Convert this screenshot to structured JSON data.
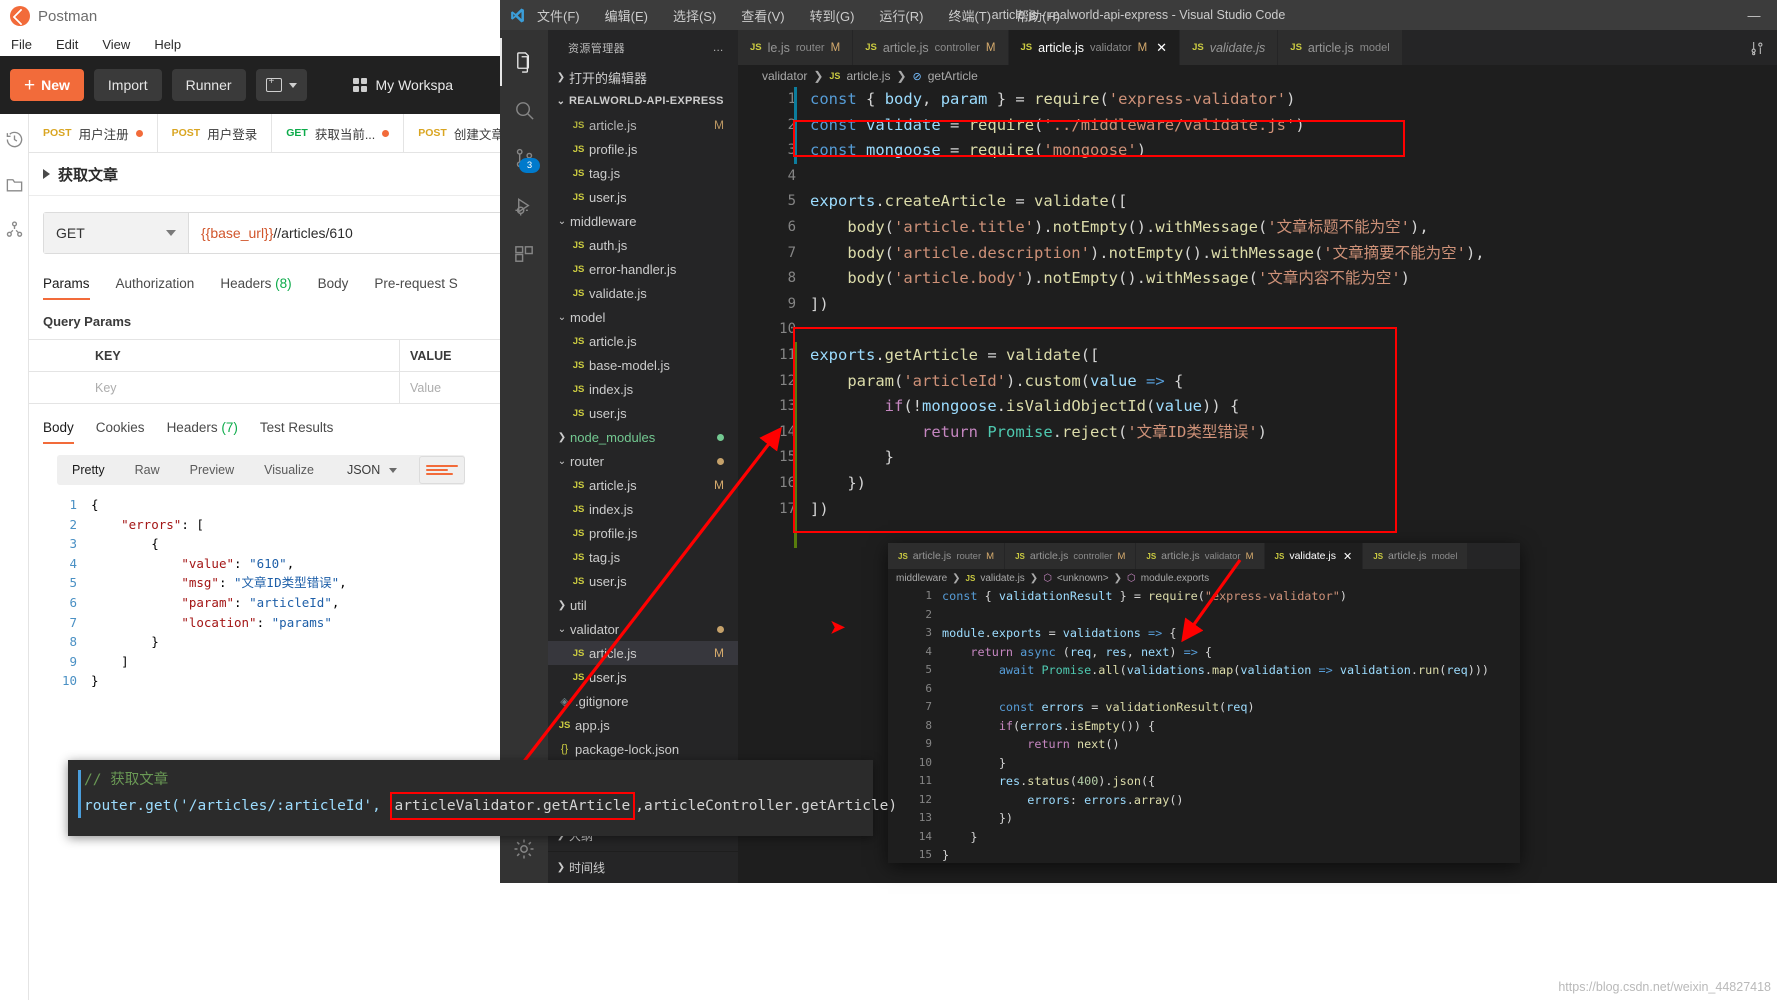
{
  "postman": {
    "app_title": "Postman",
    "menu": [
      "File",
      "Edit",
      "View",
      "Help"
    ],
    "toolbar": {
      "new_label": "New",
      "import_label": "Import",
      "runner_label": "Runner",
      "workspace_label": "My Workspa"
    },
    "request_tabs": [
      {
        "method": "POST",
        "name": "用户注册",
        "dirty": true
      },
      {
        "method": "POST",
        "name": "用户登录",
        "dirty": false
      },
      {
        "method": "GET",
        "name": "获取当前...",
        "dirty": true
      },
      {
        "method": "POST",
        "name": "创建文章",
        "dirty": false
      }
    ],
    "breadcrumb": "获取文章",
    "url_bar": {
      "method": "GET",
      "variable": "{{base_url}}",
      "path": "//articles/610"
    },
    "request_tabs_row": [
      {
        "label": "Params",
        "active": true
      },
      {
        "label": "Authorization",
        "active": false
      },
      {
        "label": "Headers",
        "count": "(8)",
        "active": false
      },
      {
        "label": "Body",
        "active": false
      },
      {
        "label": "Pre-request S",
        "active": false
      }
    ],
    "query_params_title": "Query Params",
    "table": {
      "headers": [
        "KEY",
        "VALUE"
      ],
      "placeholder_row": [
        "Key",
        "Value"
      ]
    },
    "response_tabs": [
      {
        "label": "Body",
        "active": true
      },
      {
        "label": "Cookies",
        "active": false
      },
      {
        "label": "Headers",
        "count": "(7)",
        "active": false
      },
      {
        "label": "Test Results",
        "active": false
      }
    ],
    "format_bar": {
      "modes": [
        "Pretty",
        "Raw",
        "Preview",
        "Visualize"
      ],
      "active_mode": "Pretty",
      "content_type": "JSON"
    },
    "response_json_lines": [
      {
        "n": "1",
        "text": "{"
      },
      {
        "n": "2",
        "text": "    \"errors\": ["
      },
      {
        "n": "3",
        "text": "        {"
      },
      {
        "n": "4",
        "text": "            \"value\": \"610\","
      },
      {
        "n": "5",
        "text": "            \"msg\": \"文章ID类型错误\","
      },
      {
        "n": "6",
        "text": "            \"param\": \"articleId\","
      },
      {
        "n": "7",
        "text": "            \"location\": \"params\""
      },
      {
        "n": "8",
        "text": "        }"
      },
      {
        "n": "9",
        "text": "    ]"
      },
      {
        "n": "10",
        "text": "}"
      }
    ]
  },
  "vscode": {
    "window_title": "article.js - realworld-api-express - Visual Studio Code",
    "menu": [
      "文件(F)",
      "编辑(E)",
      "选择(S)",
      "查看(V)",
      "转到(G)",
      "运行(R)",
      "终端(T)",
      "帮助(H)"
    ],
    "minimize_label": "—",
    "sidebar": {
      "header": "资源管理器",
      "more_label": "…",
      "open_editors": "打开的编辑器",
      "project_root": "REALWORLD-API-EXPRESS",
      "outline": "大纲",
      "timeline": "时间线",
      "tree": [
        {
          "indent": 2,
          "icon": "js",
          "name": "article.js",
          "mark": "M",
          "cut": true
        },
        {
          "indent": 2,
          "icon": "js",
          "name": "profile.js"
        },
        {
          "indent": 2,
          "icon": "js",
          "name": "tag.js"
        },
        {
          "indent": 2,
          "icon": "js",
          "name": "user.js"
        },
        {
          "indent": 1,
          "icon": "open",
          "name": "middleware",
          "folder": true
        },
        {
          "indent": 2,
          "icon": "js",
          "name": "auth.js"
        },
        {
          "indent": 2,
          "icon": "js",
          "name": "error-handler.js"
        },
        {
          "indent": 2,
          "icon": "js",
          "name": "validate.js"
        },
        {
          "indent": 1,
          "icon": "open",
          "name": "model",
          "folder": true
        },
        {
          "indent": 2,
          "icon": "js",
          "name": "article.js"
        },
        {
          "indent": 2,
          "icon": "js",
          "name": "base-model.js"
        },
        {
          "indent": 2,
          "icon": "js",
          "name": "index.js"
        },
        {
          "indent": 2,
          "icon": "js",
          "name": "user.js"
        },
        {
          "indent": 1,
          "icon": "closed",
          "name": "node_modules",
          "folder": true,
          "green": true,
          "dot": "#73c991"
        },
        {
          "indent": 1,
          "icon": "open",
          "name": "router",
          "folder": true,
          "dot": "#c5a16a"
        },
        {
          "indent": 2,
          "icon": "js",
          "name": "article.js",
          "mark": "M"
        },
        {
          "indent": 2,
          "icon": "js",
          "name": "index.js"
        },
        {
          "indent": 2,
          "icon": "js",
          "name": "profile.js"
        },
        {
          "indent": 2,
          "icon": "js",
          "name": "tag.js"
        },
        {
          "indent": 2,
          "icon": "js",
          "name": "user.js"
        },
        {
          "indent": 1,
          "icon": "closed",
          "name": "util",
          "folder": true
        },
        {
          "indent": 1,
          "icon": "open",
          "name": "validator",
          "folder": true,
          "dot": "#c5a16a"
        },
        {
          "indent": 2,
          "icon": "js",
          "name": "article.js",
          "mark": "M",
          "selected": true
        },
        {
          "indent": 2,
          "icon": "js",
          "name": "user.js"
        },
        {
          "indent": 1,
          "icon": "git",
          "name": ".gitignore"
        },
        {
          "indent": 1,
          "icon": "js",
          "name": "app.js"
        },
        {
          "indent": 1,
          "icon": "json",
          "name": "package-lock.json"
        }
      ]
    },
    "editor_tabs": [
      {
        "js": "JS",
        "name": "le.js",
        "desc": "router",
        "mark": "M",
        "active": false,
        "italic": false
      },
      {
        "js": "JS",
        "name": "article.js",
        "desc": "controller",
        "mark": "M",
        "active": false,
        "italic": false
      },
      {
        "js": "JS",
        "name": "article.js",
        "desc": "validator",
        "mark": "M",
        "active": true,
        "italic": false,
        "close": "✕"
      },
      {
        "js": "JS",
        "name": "validate.js",
        "desc": "",
        "mark": "",
        "active": false,
        "italic": true
      },
      {
        "js": "JS",
        "name": "article.js",
        "desc": "model",
        "mark": "",
        "active": false,
        "italic": false
      }
    ],
    "breadcrumb": {
      "folder": "validator",
      "file": "article.js",
      "symbol": "getArticle"
    },
    "code_lines": [
      {
        "n": "1",
        "html": "<span class=\"kw\">const</span> <span class=\"op\">{</span> <span class=\"vr\">body</span><span class=\"op\">,</span> <span class=\"vr\">param</span> <span class=\"op\">}</span> <span class=\"op\">=</span> <span class=\"fn\">require</span><span class=\"op\">(</span><span class=\"st\">'express-validator'</span><span class=\"op\">)</span>"
      },
      {
        "n": "2",
        "html": "<span class=\"kw\">const</span> <span class=\"vr\">validate</span> <span class=\"op\">=</span> <span class=\"fn\">require</span><span class=\"op\">(</span><span class=\"st\">'../middleware/validate.js'</span><span class=\"op\">)</span>"
      },
      {
        "n": "3",
        "html": "<span class=\"kw\">const</span> <span class=\"vr\">mongoose</span> <span class=\"op\">=</span> <span class=\"fn\">require</span><span class=\"op\">(</span><span class=\"st\">'mongoose'</span><span class=\"op\">)</span>"
      },
      {
        "n": "4",
        "html": ""
      },
      {
        "n": "5",
        "html": "<span class=\"vr\">exports</span><span class=\"op\">.</span><span class=\"fn\">createArticle</span> <span class=\"op\">=</span> <span class=\"fn\">validate</span><span class=\"op\">([</span>"
      },
      {
        "n": "6",
        "html": "    <span class=\"fn\">body</span><span class=\"op\">(</span><span class=\"st\">'article.title'</span><span class=\"op\">).</span><span class=\"fn\">notEmpty</span><span class=\"op\">().</span><span class=\"fn\">withMessage</span><span class=\"op\">(</span><span class=\"st\">'文章标题不能为空'</span><span class=\"op\">),</span>"
      },
      {
        "n": "7",
        "html": "    <span class=\"fn\">body</span><span class=\"op\">(</span><span class=\"st\">'article.description'</span><span class=\"op\">).</span><span class=\"fn\">notEmpty</span><span class=\"op\">().</span><span class=\"fn\">withMessage</span><span class=\"op\">(</span><span class=\"st\">'文章摘要不能为空'</span><span class=\"op\">),</span>"
      },
      {
        "n": "8",
        "html": "    <span class=\"fn\">body</span><span class=\"op\">(</span><span class=\"st\">'article.body'</span><span class=\"op\">).</span><span class=\"fn\">notEmpty</span><span class=\"op\">().</span><span class=\"fn\">withMessage</span><span class=\"op\">(</span><span class=\"st\">'文章内容不能为空'</span><span class=\"op\">)</span>"
      },
      {
        "n": "9",
        "html": "<span class=\"op\">])</span>"
      },
      {
        "n": "10",
        "html": ""
      },
      {
        "n": "11",
        "html": "<span class=\"vr\">exports</span><span class=\"op\">.</span><span class=\"fn\">getArticle</span> <span class=\"op\">=</span> <span class=\"fn\">validate</span><span class=\"op\">([</span>"
      },
      {
        "n": "12",
        "html": "    <span class=\"fn\">param</span><span class=\"op\">(</span><span class=\"st\">'articleId'</span><span class=\"op\">).</span><span class=\"fn\">custom</span><span class=\"op\">(</span><span class=\"vr\">value</span> <span class=\"kw\">=&gt;</span> <span class=\"op\">{</span>"
      },
      {
        "n": "13",
        "html": "        <span class=\"kw2\">if</span><span class=\"op\">(!</span><span class=\"vr\">mongoose</span><span class=\"op\">.</span><span class=\"fn\">isValidObjectId</span><span class=\"op\">(</span><span class=\"vr\">value</span><span class=\"op\">)) {</span>"
      },
      {
        "n": "14",
        "html": "            <span class=\"kw2\">return</span> <span class=\"cls\">Promise</span><span class=\"op\">.</span><span class=\"fn\">reject</span><span class=\"op\">(</span><span class=\"st\">'文章ID类型错误'</span><span class=\"op\">)</span>"
      },
      {
        "n": "15",
        "html": "        <span class=\"op\">}</span>"
      },
      {
        "n": "16",
        "html": "    <span class=\"op\">})</span>"
      },
      {
        "n": "17",
        "html": "<span class=\"op\">])</span>"
      }
    ],
    "popup": {
      "tabs": [
        {
          "js": "JS",
          "name": "article.js",
          "desc": "router",
          "mark": "M",
          "active": false,
          "italic": false
        },
        {
          "js": "JS",
          "name": "article.js",
          "desc": "controller",
          "mark": "M",
          "active": false,
          "italic": false
        },
        {
          "js": "JS",
          "name": "article.js",
          "desc": "validator",
          "mark": "M",
          "active": false,
          "italic": false
        },
        {
          "js": "JS",
          "name": "validate.js",
          "desc": "",
          "mark": "",
          "active": true,
          "italic": true,
          "close": "✕"
        },
        {
          "js": "JS",
          "name": "article.js",
          "desc": "model",
          "mark": "",
          "active": false,
          "italic": false
        }
      ],
      "breadcrumb": {
        "folder": "middleware",
        "file": "validate.js",
        "sym1": "<unknown>",
        "sym2": "module.exports"
      },
      "code_lines": [
        {
          "n": "1",
          "html": "<span class=\"kw\">const</span> <span class=\"op\">{</span> <span class=\"vr\">validationResult</span> <span class=\"op\">}</span> <span class=\"op\">=</span> <span class=\"fn\">require</span><span class=\"op\">(</span><span class=\"st\">\"express-validator\"</span><span class=\"op\">)</span>"
        },
        {
          "n": "2",
          "html": ""
        },
        {
          "n": "3",
          "html": "<span class=\"vr\">module</span><span class=\"op\">.</span><span class=\"vr\">exports</span> <span class=\"op\">=</span> <span class=\"vr\">validations</span> <span class=\"kw\">=&gt;</span> <span class=\"op\">{</span>"
        },
        {
          "n": "4",
          "html": "    <span class=\"kw2\">return</span> <span class=\"kw\">async</span> <span class=\"op\">(</span><span class=\"vr\">req</span><span class=\"op\">,</span> <span class=\"vr\">res</span><span class=\"op\">,</span> <span class=\"vr\">next</span><span class=\"op\">)</span> <span class=\"kw\">=&gt;</span> <span class=\"op\">{</span>"
        },
        {
          "n": "5",
          "html": "        <span class=\"kw\">await</span> <span class=\"cls\">Promise</span><span class=\"op\">.</span><span class=\"fn\">all</span><span class=\"op\">(</span><span class=\"vr\">validations</span><span class=\"op\">.</span><span class=\"fn\">map</span><span class=\"op\">(</span><span class=\"vr\">validation</span> <span class=\"kw\">=&gt;</span> <span class=\"vr\">validation</span><span class=\"op\">.</span><span class=\"fn\">run</span><span class=\"op\">(</span><span class=\"vr\">req</span><span class=\"op\">)))</span>"
        },
        {
          "n": "6",
          "html": ""
        },
        {
          "n": "7",
          "html": "        <span class=\"kw\">const</span> <span class=\"vr\">errors</span> <span class=\"op\">=</span> <span class=\"fn\">validationResult</span><span class=\"op\">(</span><span class=\"vr\">req</span><span class=\"op\">)</span>"
        },
        {
          "n": "8",
          "html": "        <span class=\"kw2\">if</span><span class=\"op\">(</span><span class=\"vr\">errors</span><span class=\"op\">.</span><span class=\"fn\">isEmpty</span><span class=\"op\">()) {</span>"
        },
        {
          "n": "9",
          "html": "            <span class=\"kw2\">return</span> <span class=\"fn\">next</span><span class=\"op\">()</span>"
        },
        {
          "n": "10",
          "html": "        <span class=\"op\">}</span>"
        },
        {
          "n": "11",
          "html": "        <span class=\"vr\">res</span><span class=\"op\">.</span><span class=\"fn\">status</span><span class=\"op\">(</span><span class=\"num\">400</span><span class=\"op\">).</span><span class=\"fn\">json</span><span class=\"op\">({</span>"
        },
        {
          "n": "12",
          "html": "            <span class=\"vr\">errors</span><span class=\"op\">:</span> <span class=\"vr\">errors</span><span class=\"op\">.</span><span class=\"fn\">array</span><span class=\"op\">()</span>"
        },
        {
          "n": "13",
          "html": "        <span class=\"op\">})</span>"
        },
        {
          "n": "14",
          "html": "    <span class=\"op\">}</span>"
        },
        {
          "n": "15",
          "html": "<span class=\"op\">}</span>"
        }
      ]
    }
  },
  "router_overlay": {
    "comment": "// 获取文章",
    "prefix": "router.get('/articles/:articleId', ",
    "highlight": "articleValidator.getArticle",
    "suffix": ",articleController.getArticle)"
  },
  "watermark": "https://blog.csdn.net/weixin_44827418"
}
